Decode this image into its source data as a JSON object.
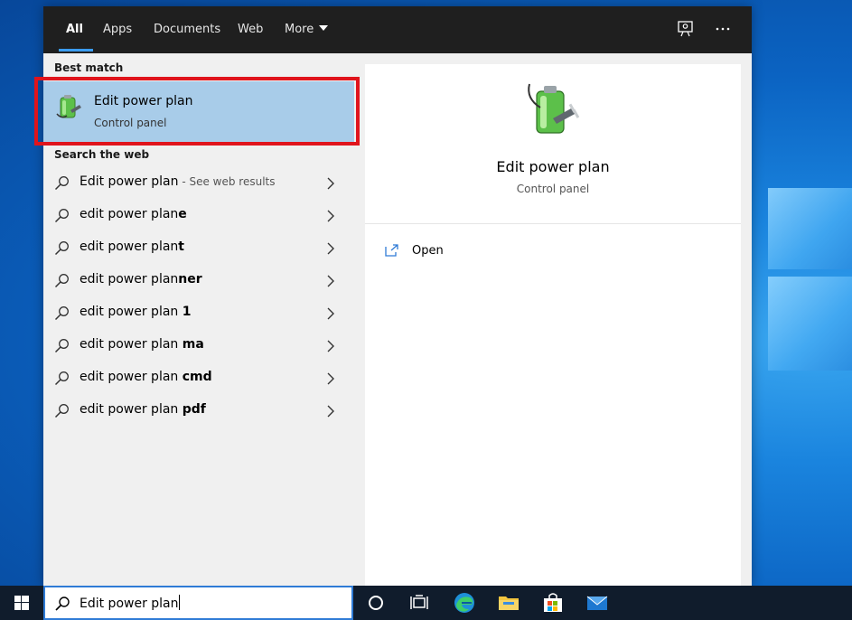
{
  "tabs": [
    {
      "label": "All"
    },
    {
      "label": "Apps"
    },
    {
      "label": "Documents"
    },
    {
      "label": "Web"
    },
    {
      "label": "More"
    }
  ],
  "best_match": {
    "section_label": "Best match",
    "title": "Edit power plan",
    "subtitle": "Control panel"
  },
  "web": {
    "section_label": "Search the web",
    "suggestions": [
      {
        "prefix": "Edit power plan",
        "bold": "",
        "suffix": " - See web results"
      },
      {
        "prefix": "edit power plan",
        "bold": "e",
        "suffix": ""
      },
      {
        "prefix": "edit power plan",
        "bold": "t",
        "suffix": ""
      },
      {
        "prefix": "edit power plan",
        "bold": "ner",
        "suffix": ""
      },
      {
        "prefix": "edit power plan ",
        "bold": "1",
        "suffix": ""
      },
      {
        "prefix": "edit power plan ",
        "bold": "ma",
        "suffix": ""
      },
      {
        "prefix": "edit power plan ",
        "bold": "cmd",
        "suffix": ""
      },
      {
        "prefix": "edit power plan ",
        "bold": "pdf",
        "suffix": ""
      }
    ]
  },
  "preview": {
    "title": "Edit power plan",
    "subtitle": "Control panel",
    "open_label": "Open"
  },
  "taskbar": {
    "search_value": "Edit power plan"
  },
  "colors": {
    "accent": "#3b9cf0",
    "selection": "#a8cce9",
    "highlight_border": "#e0141c",
    "topbar": "#1f1f1f",
    "taskbar": "#101c2c"
  }
}
